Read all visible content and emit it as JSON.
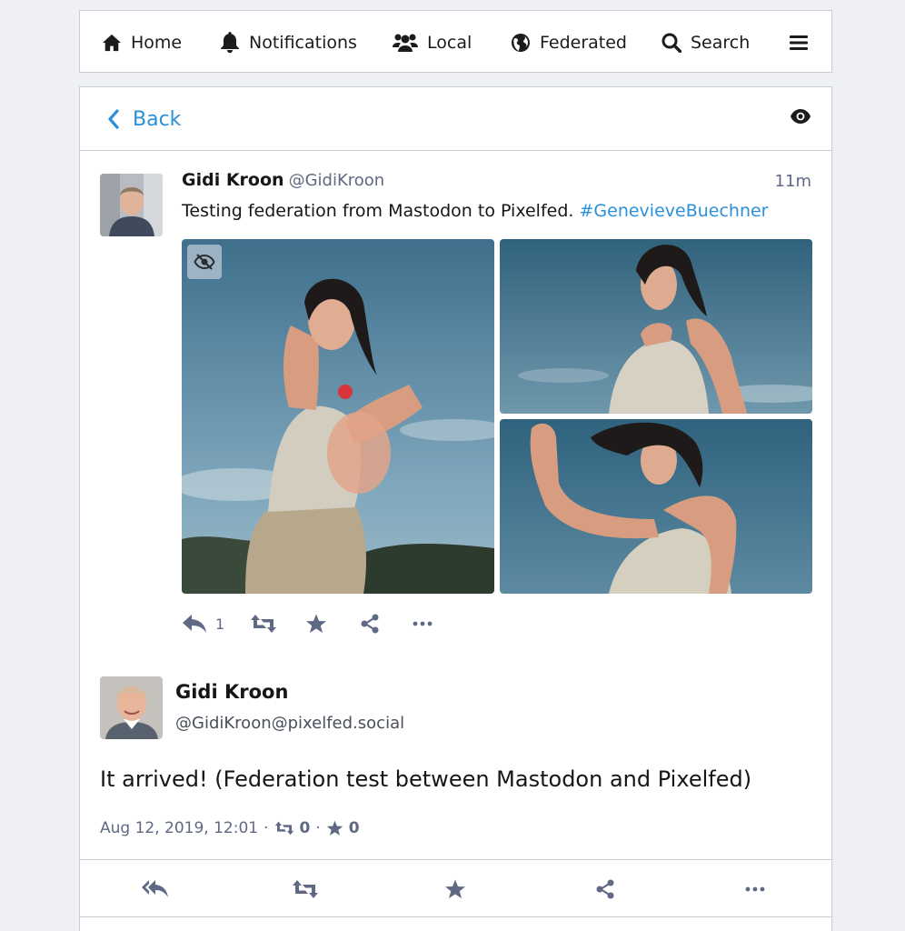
{
  "nav": {
    "home": "Home",
    "notifications": "Notifications",
    "local": "Local",
    "federated": "Federated",
    "search": "Search"
  },
  "back": {
    "label": "Back"
  },
  "status": {
    "display_name": "Gidi Kroon",
    "handle": "@GidiKroon",
    "time": "11m",
    "text": "Testing federation from Mastodon to Pixelfed.",
    "hashtag": "#GenevieveBuechner",
    "reply_count": "1"
  },
  "detail": {
    "display_name": "Gidi Kroon",
    "handle": "@GidiKroon@pixelfed.social",
    "text": "It arrived! (Federation test between Mastodon and Pixelfed)",
    "date": "Aug 12, 2019, 12:01",
    "separator": "·",
    "reblogs": "0",
    "favourites": "0"
  },
  "colors": {
    "accent": "#2b90d9",
    "muted": "#606984",
    "background": "#eef0f4"
  }
}
